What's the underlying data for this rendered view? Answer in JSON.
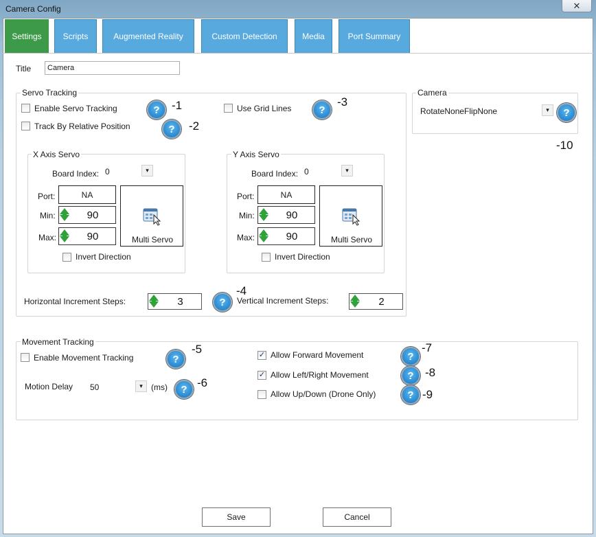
{
  "window": {
    "title": "Camera Config",
    "close_glyph": "✕"
  },
  "tabs": [
    {
      "label": "Settings",
      "active": true
    },
    {
      "label": "Scripts"
    },
    {
      "label": "Augmented Reality"
    },
    {
      "label": "Custom Detection"
    },
    {
      "label": "Media"
    },
    {
      "label": "Port Summary"
    }
  ],
  "title_field": {
    "label": "Title",
    "value": "Camera"
  },
  "servo_tracking": {
    "label": "Servo Tracking",
    "enable_label": "Enable Servo Tracking",
    "relative_label": "Track By Relative Position",
    "grid_label": "Use Grid Lines",
    "annot": [
      "-1",
      "-2",
      "-3",
      "-4"
    ],
    "x_axis": {
      "label": "X Axis Servo",
      "board_index_label": "Board Index:",
      "board_index": "0",
      "port_label": "Port:",
      "port": "NA",
      "min_label": "Min:",
      "min": "90",
      "max_label": "Max:",
      "max": "90",
      "multi_servo": "Multi Servo",
      "invert_label": "Invert Direction"
    },
    "y_axis": {
      "label": "Y Axis Servo",
      "board_index_label": "Board Index:",
      "board_index": "0",
      "port_label": "Port:",
      "port": "NA",
      "min_label": "Min:",
      "min": "90",
      "max_label": "Max:",
      "max": "90",
      "multi_servo": "Multi Servo",
      "invert_label": "Invert Direction"
    },
    "horizontal_label": "Horizontal Increment Steps:",
    "horizontal_value": "3",
    "vertical_label": "Vertical Increment Steps:",
    "vertical_value": "2"
  },
  "camera": {
    "label": "Camera",
    "rotation": "RotateNoneFlipNone",
    "annot": "-10"
  },
  "movement_tracking": {
    "label": "Movement Tracking",
    "enable_label": "Enable Movement Tracking",
    "motion_delay_label": "Motion Delay",
    "motion_delay": "50",
    "motion_delay_unit": "(ms)",
    "forward_label": "Allow Forward Movement",
    "forward_checked": true,
    "leftright_label": "Allow Left/Right Movement",
    "leftright_checked": true,
    "updown_label": "Allow Up/Down (Drone Only)",
    "updown_checked": false,
    "annot": [
      "-5",
      "-6",
      "-7",
      "-8",
      "-9"
    ]
  },
  "buttons": {
    "save": "Save",
    "cancel": "Cancel"
  },
  "icons": {
    "help": "?",
    "check": "✓",
    "dropdown": "▾"
  }
}
